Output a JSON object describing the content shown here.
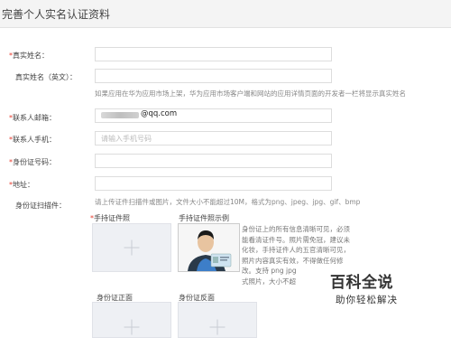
{
  "header": {
    "title": "完善个人实名认证资料"
  },
  "fields": {
    "real_name": {
      "required": "*",
      "label": "真实姓名：",
      "value": ""
    },
    "real_name_en": {
      "label": "真实姓名（英文）：",
      "value": ""
    },
    "name_hint": "如果应用在华为应用市场上架，华为应用市场客户端和网站的应用详情页面的开发者一栏将显示真实姓名",
    "email": {
      "required": "*",
      "label": "联系人邮箱：",
      "value": "@qq.com"
    },
    "phone": {
      "required": "*",
      "label": "联系人手机：",
      "placeholder": "请输入手机号码"
    },
    "id_number": {
      "required": "*",
      "label": "身份证号码：",
      "value": ""
    },
    "address": {
      "required": "*",
      "label": "地址：",
      "value": ""
    },
    "id_scan": {
      "label": "身份证扫描件：",
      "hint": "请上传证件扫描件或图片，文件大小不能超过10M，格式为png、jpeg、jpg、gif、bmp"
    }
  },
  "upload": {
    "hand_held": {
      "required": "*",
      "label": "手持证件照"
    },
    "sample_label": "手持证件照示例",
    "front_label": "身份证正面",
    "back_label": "身份证反面",
    "description_lines": [
      "身份证上的所有信息清晰可见，必须",
      "能看清证件号。照片需免冠，建议未",
      "化妆，手持证件人的五官清晰可见，",
      "照片内容真实有效，不得做任何修",
      "改。支持 png jpg",
      "式照片，大小不超"
    ]
  },
  "watermark": {
    "line1": "百科全说",
    "line2": "助你轻松解决"
  }
}
